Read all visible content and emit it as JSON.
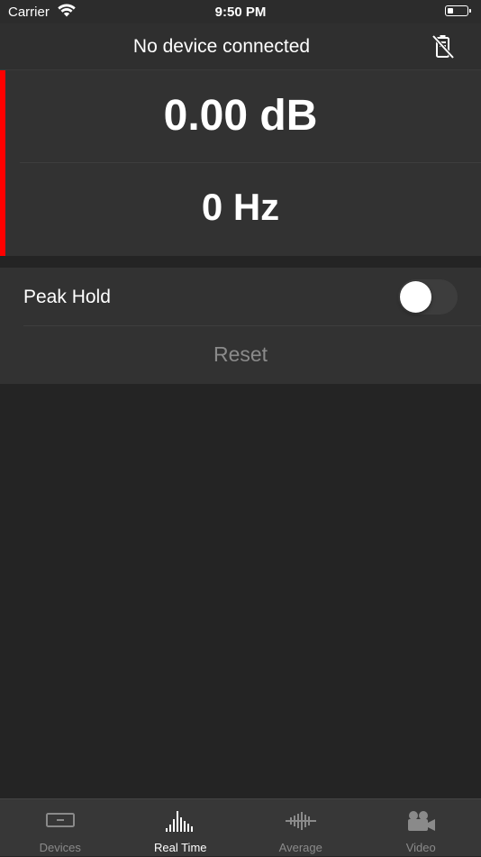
{
  "status_bar": {
    "carrier": "Carrier",
    "time": "9:50 PM",
    "battery_level": 0.3
  },
  "nav_bar": {
    "title": "No device connected",
    "device_icon": "device-disconnected-icon"
  },
  "meter": {
    "db_value": "0.00 dB",
    "hz_value": "0 Hz",
    "level_bar_color": "#ff0000"
  },
  "settings": {
    "peak_hold_label": "Peak Hold",
    "peak_hold_on": false,
    "reset_label": "Reset"
  },
  "tabs": [
    {
      "label": "Devices",
      "icon": "devices-icon",
      "active": false
    },
    {
      "label": "Real Time",
      "icon": "real-time-spectrum-icon",
      "active": true
    },
    {
      "label": "Average",
      "icon": "average-spectrum-icon",
      "active": false
    },
    {
      "label": "Video",
      "icon": "video-camera-icon",
      "active": false
    }
  ],
  "colors": {
    "background": "#242424",
    "panel": "#323232",
    "accent_red": "#ff0000",
    "inactive_text": "#8a8a8a"
  }
}
